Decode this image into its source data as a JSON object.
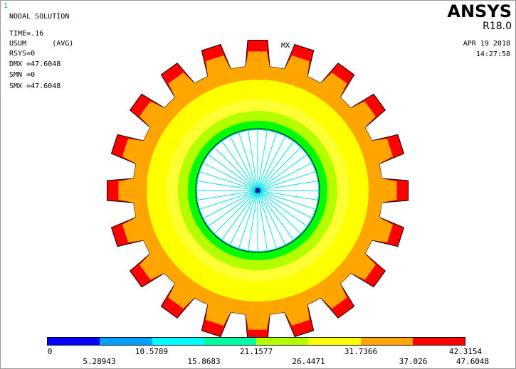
{
  "window": {
    "id": "1"
  },
  "header": {
    "title": "NODAL SOLUTION",
    "time": "TIME=.16",
    "quantity": "USUM      (AVG)",
    "rsys": "RSYS=0",
    "dmx": "DMX =47.6048",
    "smn": "SMN =0",
    "smx": "SMX =47.6048"
  },
  "marker": {
    "max_label": "MX"
  },
  "brand": {
    "name": "ANSYS",
    "version": "R18.0"
  },
  "datetime": {
    "date": "APR 19 2018",
    "time": "14:27:58"
  },
  "model": {
    "teeth_count": 20,
    "hub_spokes": 40,
    "band_colors": [
      "#ff0000",
      "#ffa500",
      "#ffff00",
      "#b3ff00",
      "#00ff00"
    ],
    "hub_color": "#00e5e5",
    "outline_color": "#000000"
  },
  "legend": {
    "colors": [
      "#0000ff",
      "#00a0ff",
      "#00ffff",
      "#00ffa0",
      "#b3ff00",
      "#ffff00",
      "#ffa500",
      "#ff0000"
    ],
    "labels_top": [
      "0",
      "10.5789",
      "21.1577",
      "31.7366",
      "42.3154"
    ],
    "labels_bottom": [
      "5.28943",
      "15.8683",
      "26.4471",
      "37.026",
      "47.6048"
    ]
  }
}
